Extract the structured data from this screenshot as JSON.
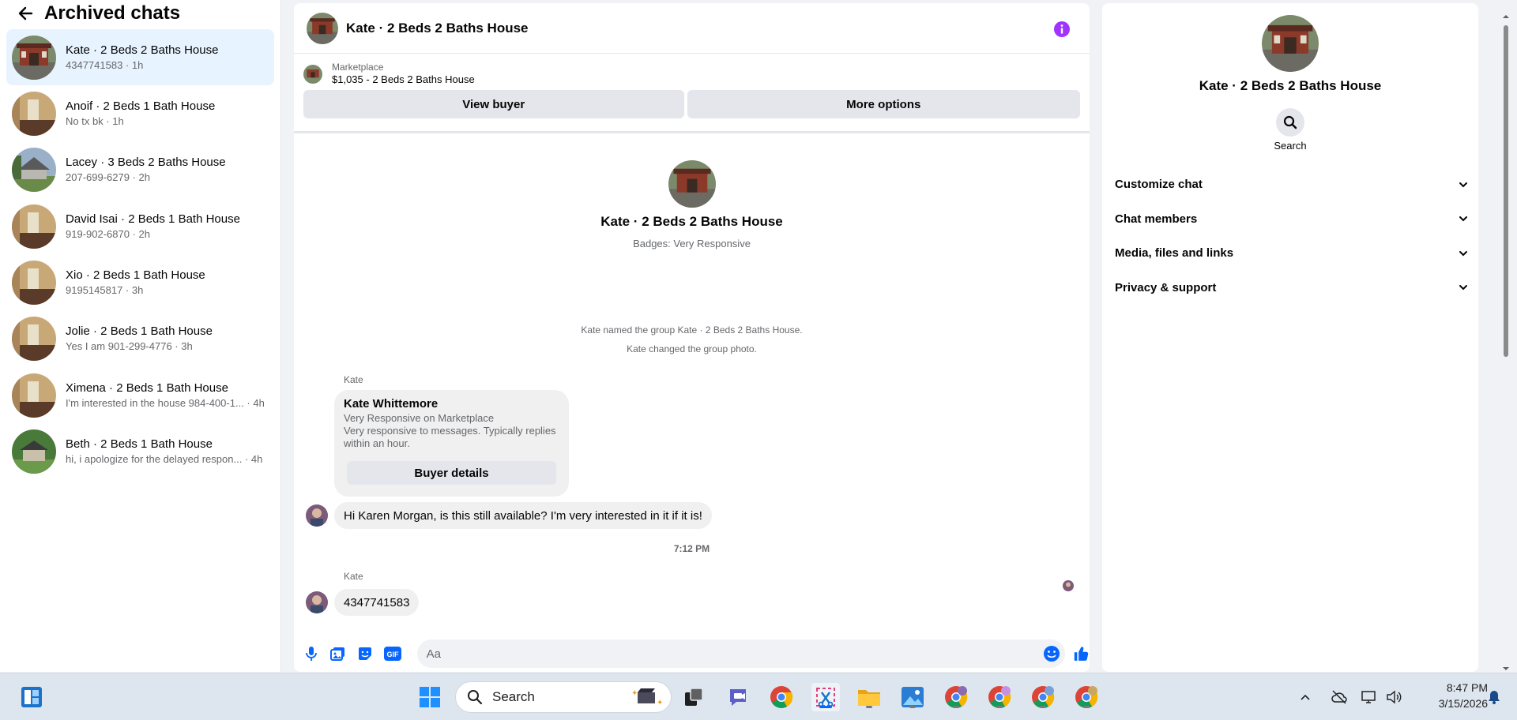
{
  "sidebar": {
    "title": "Archived chats",
    "chats": [
      {
        "name": "Kate · 2 Beds 2 Baths House",
        "meta": "4347741583 · 1h",
        "thumb": "brick-house"
      },
      {
        "name": "Anoif · 2 Beds 1 Bath House",
        "meta": "No tx bk · 1h",
        "thumb": "room"
      },
      {
        "name": "Lacey · 3 Beds 2 Baths House",
        "meta": "207-699-6279 · 2h",
        "thumb": "gray-house"
      },
      {
        "name": "David Isai · 2 Beds 1 Bath House",
        "meta": "919-902-6870 · 2h",
        "thumb": "room"
      },
      {
        "name": "Xio · 2 Beds 1 Bath House",
        "meta": "9195145817 · 3h",
        "thumb": "room"
      },
      {
        "name": "Jolie · 2 Beds 1 Bath House",
        "meta": "Yes I am 901-299-4776 · 3h",
        "thumb": "room"
      },
      {
        "name": "Ximena · 2 Beds 1 Bath House",
        "meta": "I'm interested in the house 984-400-1... · 4h",
        "thumb": "room"
      },
      {
        "name": "Beth · 2 Beds 1 Bath House",
        "meta": "hi, i apologize for the delayed respon... · 4h",
        "thumb": "green-house"
      }
    ]
  },
  "conversation": {
    "title": "Kate · 2 Beds 2 Baths House",
    "marketplace_label": "Marketplace",
    "listing": "$1,035 - 2 Beds 2 Baths House",
    "view_buyer": "View buyer",
    "more_options": "More options",
    "intro_name": "Kate · 2 Beds 2 Baths House",
    "intro_badges": "Badges: Very Responsive",
    "system_1": "Kate named the group Kate · 2 Beds 2 Baths House.",
    "system_2": "Kate changed the group photo.",
    "sender_1": "Kate",
    "card_name": "Kate Whittemore",
    "card_line_1": "Very Responsive on Marketplace",
    "card_line_2": "Very responsive to messages. Typically replies within an hour.",
    "card_button": "Buyer details",
    "message_1": "Hi Karen Morgan, is this still available? I'm very interested in it if it is!",
    "time_separator": "7:12 PM",
    "sender_2": "Kate",
    "message_2": "4347741583",
    "composer_placeholder": "Aa"
  },
  "info_panel": {
    "name": "Kate · 2 Beds 2 Baths House",
    "search_label": "Search",
    "sections": [
      "Customize chat",
      "Chat members",
      "Media, files and links",
      "Privacy & support"
    ]
  },
  "taskbar": {
    "search_label": "Search",
    "time": "8:47 PM",
    "date": "3/15/2026"
  },
  "colors": {
    "accent": "#0866ff",
    "info_purple": "#a033ff",
    "active_row": "#e7f3ff"
  }
}
